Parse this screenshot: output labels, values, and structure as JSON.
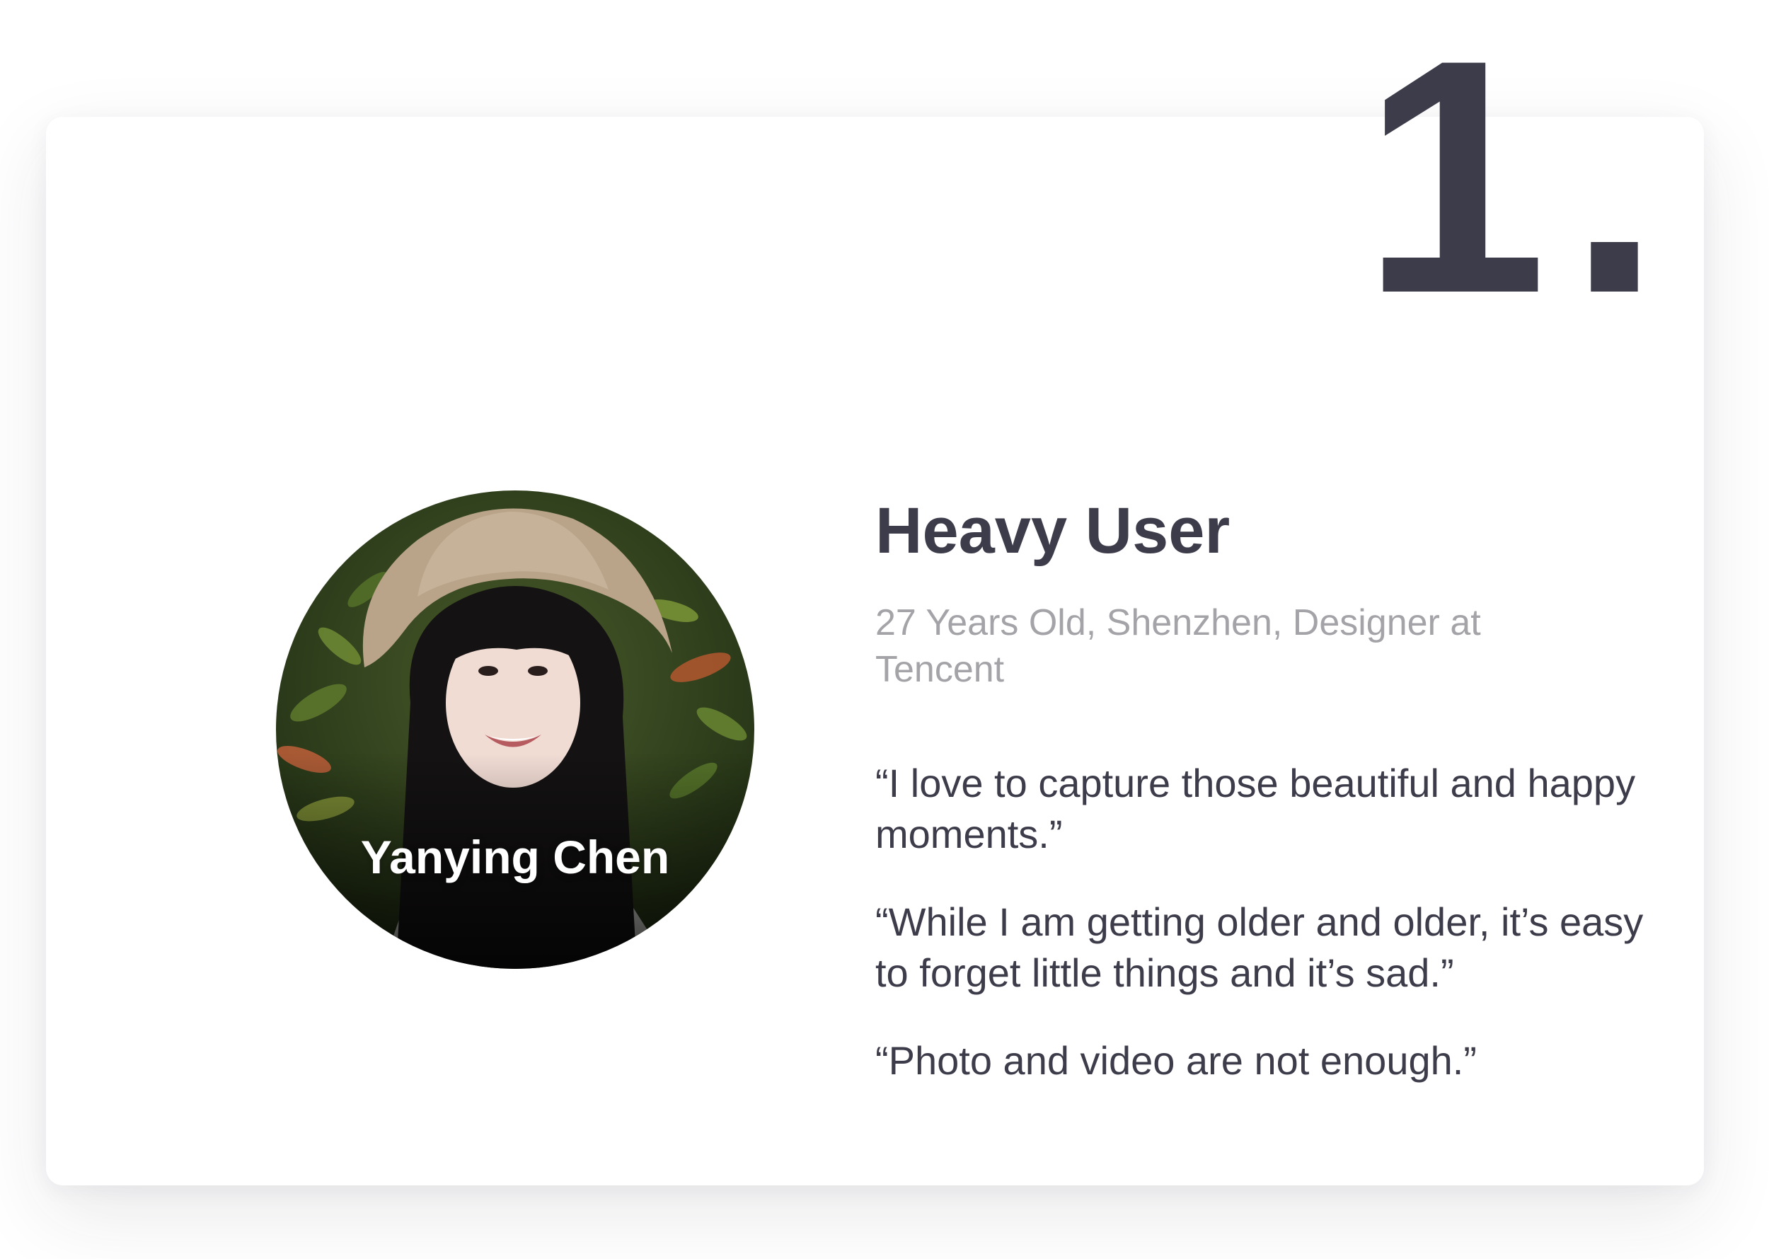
{
  "step_number": "1.",
  "persona": {
    "name": "Yanying Chen",
    "title": "Heavy User",
    "details": "27 Years Old, Shenzhen, Designer at Tencent",
    "quotes": [
      "“I love to capture those beautiful and happy moments.”",
      "“While I am getting older and older, it’s easy to forget little things and it’s sad.”",
      "“Photo and video are not enough.”"
    ]
  },
  "colors": {
    "primary_text": "#3d3c4a",
    "secondary_text": "#a3a3a8",
    "card_background": "#ffffff"
  }
}
